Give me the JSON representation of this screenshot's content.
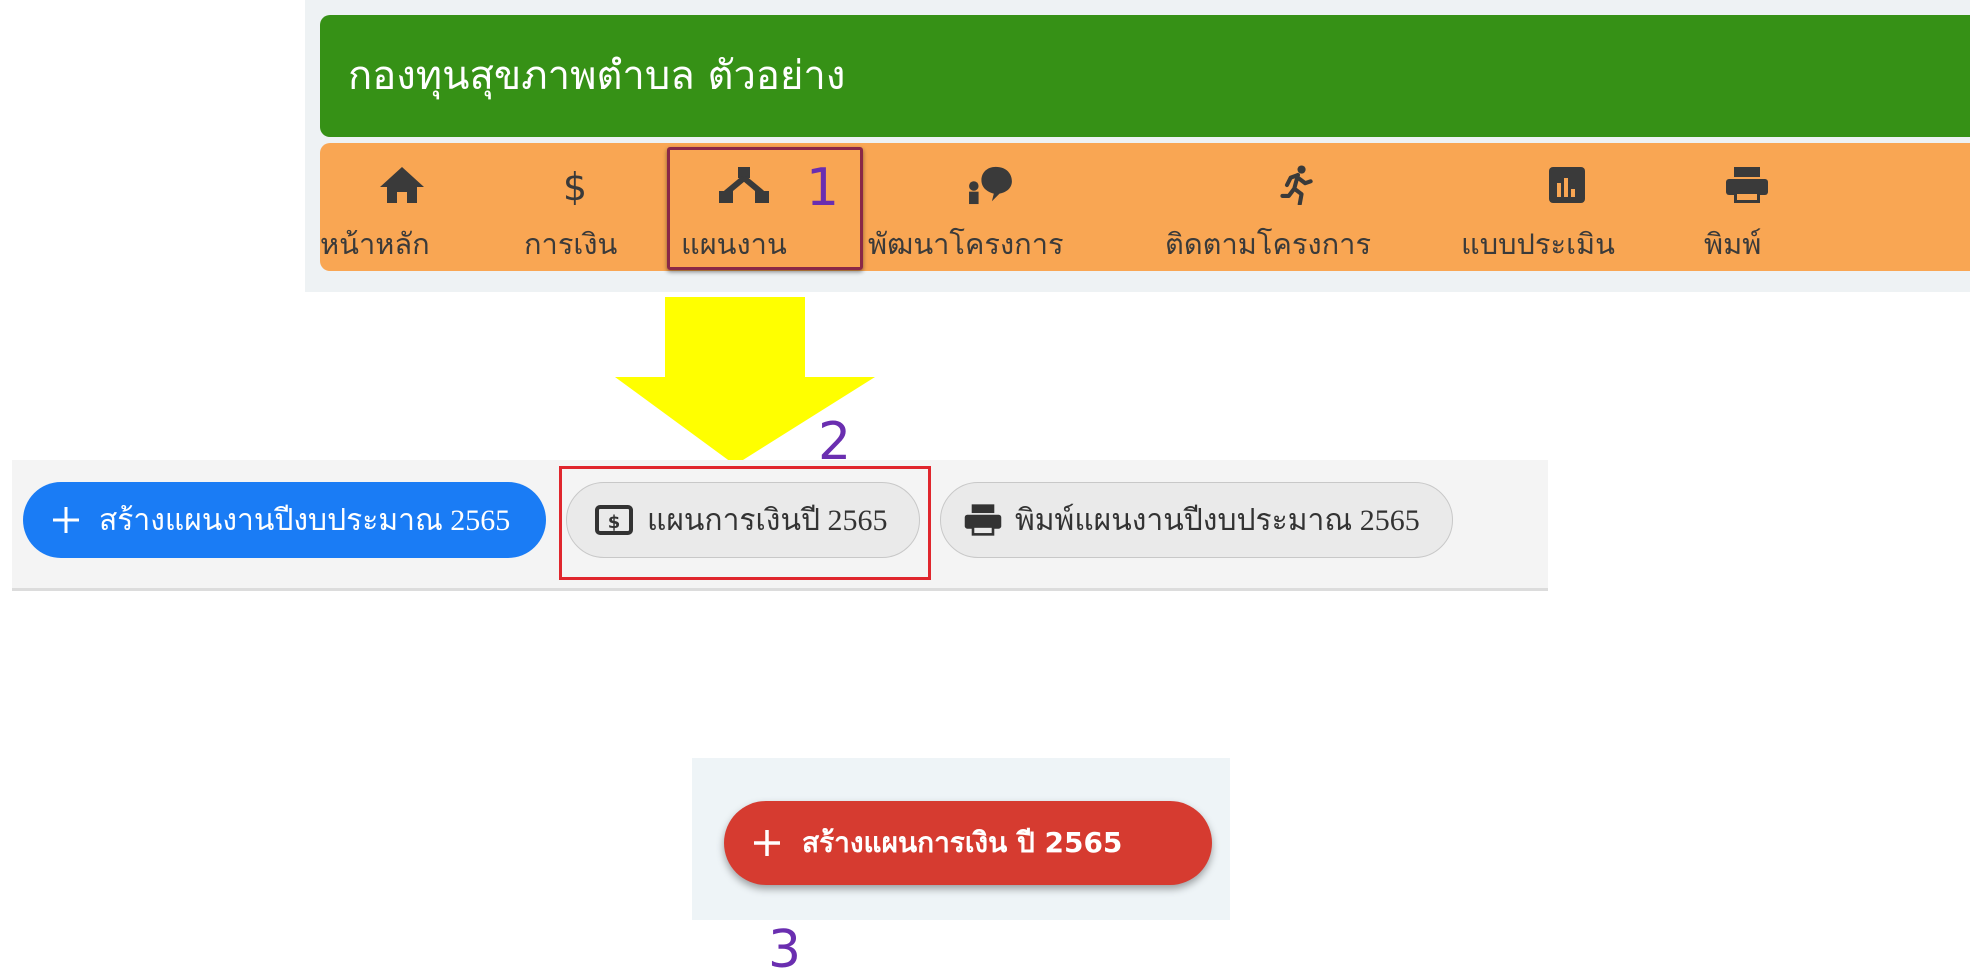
{
  "header": {
    "title": "กองทุนสุขภาพตำบล ตัวอย่าง"
  },
  "nav": {
    "items": [
      {
        "label": "หน้าหลัก",
        "icon": "home-icon"
      },
      {
        "label": "การเงิน",
        "icon": "dollar-icon"
      },
      {
        "label": "แผนงาน",
        "icon": "sitemap-icon"
      },
      {
        "label": "พัฒนาโครงการ",
        "icon": "idea-person-icon"
      },
      {
        "label": "ติดตามโครงการ",
        "icon": "running-person-icon"
      },
      {
        "label": "แบบประเมิน",
        "icon": "bar-chart-icon"
      },
      {
        "label": "พิมพ์",
        "icon": "print-icon"
      }
    ]
  },
  "steps": {
    "one": "1",
    "two": "2",
    "three": "3"
  },
  "plan_toolbar": {
    "create_plan": "สร้างแผนงานปีงบประมาณ 2565",
    "finance_plan": "แผนการเงินปี 2565",
    "print_plan": "พิมพ์แผนงานปีงบประมาณ 2565"
  },
  "finance_action": {
    "create_finance_plan": "สร้างแผนการเงิน ปี 2565"
  },
  "colors": {
    "title_bar": "#369116",
    "nav_bar": "#f9a653",
    "primary_button": "#1a7cf5",
    "danger_button": "#d63b30",
    "highlight_nav": "#8a2846",
    "highlight_button": "#e0262d",
    "arrow": "#ffff00",
    "step_number": "#6a2eb0"
  }
}
